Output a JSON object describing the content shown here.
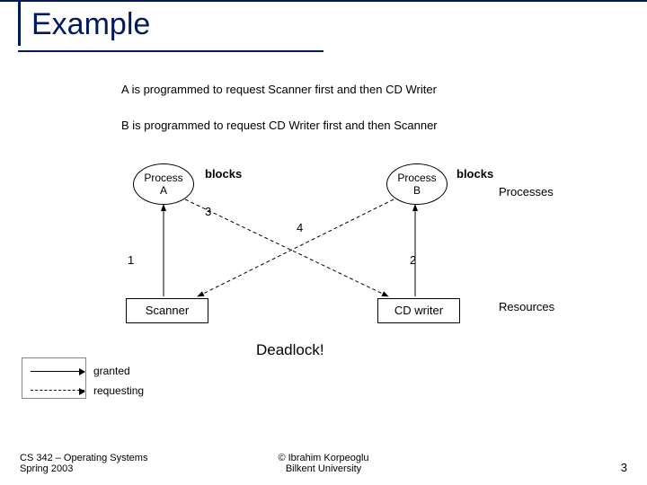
{
  "title": "Example",
  "desc1": "A is programmed to request Scanner first and then CD Writer",
  "desc2": "B is programmed to request CD Writer first and then Scanner",
  "processA": {
    "line1": "Process",
    "line2": "A"
  },
  "processB": {
    "line1": "Process",
    "line2": "B"
  },
  "blocksLabel": "blocks",
  "processesLabel": "Processes",
  "resourcesLabel": "Resources",
  "edges": {
    "n1": "1",
    "n2": "2",
    "n3": "3",
    "n4": "4"
  },
  "resourceA": "Scanner",
  "resourceB": "CD writer",
  "deadlock": "Deadlock!",
  "legend": {
    "granted": "granted",
    "requesting": "requesting"
  },
  "footer": {
    "left1": "CS 342 – Operating Systems",
    "left2": "Spring 2003",
    "center1": "© Ibrahim Korpeoglu",
    "center2": "Bilkent University",
    "right": "3"
  }
}
